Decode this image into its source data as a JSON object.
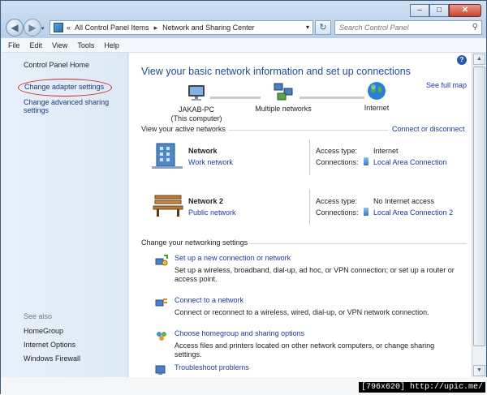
{
  "window": {
    "caption_min": "–",
    "caption_max": "□",
    "caption_close": "✕"
  },
  "nav": {
    "back_glyph": "◀",
    "forward_glyph": "▶",
    "dropdown_glyph": "▾"
  },
  "address": {
    "chevron": "«",
    "crumbs": [
      "All Control Panel Items",
      "Network and Sharing Center"
    ],
    "separator": "▸",
    "dropdown_glyph": "▾",
    "refresh_glyph": "↻"
  },
  "search": {
    "placeholder": "Search Control Panel",
    "icon_glyph": "⚲"
  },
  "menu": [
    "File",
    "Edit",
    "View",
    "Tools",
    "Help"
  ],
  "sidebar": {
    "home": "Control Panel Home",
    "adapter": "Change adapter settings",
    "advanced": "Change advanced sharing settings",
    "see_also": "See also",
    "links": [
      "HomeGroup",
      "Internet Options",
      "Windows Firewall"
    ]
  },
  "main": {
    "help_glyph": "?",
    "title": "View your basic network information and set up connections",
    "see_full_map": "See full map",
    "map": {
      "pc_name": "JAKAB-PC",
      "pc_sub": "(This computer)",
      "middle": "Multiple networks",
      "internet": "Internet"
    },
    "active_header": "View your active networks",
    "connect_disconnect": "Connect or disconnect",
    "networks": [
      {
        "name": "Network",
        "type": "Work network",
        "access_label": "Access type:",
        "access_value": "Internet",
        "conn_label": "Connections:",
        "conn_value": "Local Area Connection"
      },
      {
        "name": "Network  2",
        "type": "Public network",
        "access_label": "Access type:",
        "access_value": "No Internet access",
        "conn_label": "Connections:",
        "conn_value": "Local Area Connection 2"
      }
    ],
    "settings_header": "Change your networking settings",
    "tasks": [
      {
        "title": "Set up a new connection or network",
        "desc": "Set up a wireless, broadband, dial-up, ad hoc, or VPN connection; or set up a router or access point."
      },
      {
        "title": "Connect to a network",
        "desc": "Connect or reconnect to a wireless, wired, dial-up, or VPN network connection."
      },
      {
        "title": "Choose homegroup and sharing options",
        "desc": "Access files and printers located on other network computers, or change sharing settings."
      },
      {
        "title": "Troubleshoot problems",
        "desc": ""
      }
    ]
  },
  "scroll": {
    "up": "▲",
    "down": "▼"
  },
  "watermark": "[796x620] http://upic.me/"
}
